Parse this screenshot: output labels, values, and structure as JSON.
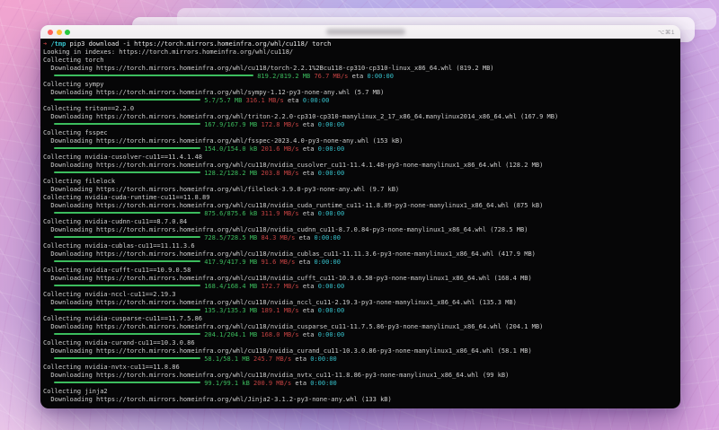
{
  "window": {
    "shortcut_badge": "⌥⌘1",
    "traffic_lights": [
      {
        "name": "close",
        "color": "#ff5f57"
      },
      {
        "name": "minimize",
        "color": "#febc2e"
      },
      {
        "name": "zoom",
        "color": "#28c840"
      }
    ]
  },
  "terminal": {
    "colors": {
      "green": "#3cbd5e",
      "red": "#c44242",
      "cyan": "#36c2cc",
      "foreground": "#cfcfcf",
      "background": "#060607"
    },
    "prompt": {
      "arrow": "➜",
      "cwd": "/tmp"
    },
    "lines": [
      {
        "type": "cmd",
        "command": "pip3 download -i https://torch.mirrors.homeinfra.org/whl/cu118/ torch"
      },
      {
        "type": "out",
        "text": "Looking in indexes: https://torch.mirrors.homeinfra.org/whl/cu118/"
      },
      {
        "type": "out",
        "text": "Collecting torch"
      },
      {
        "type": "out",
        "text": "  Downloading https://torch.mirrors.homeinfra.org/whl/cu118/torch-2.2.1%2Bcu118-cp310-cp310-linux_x86_64.whl (819.2 MB)"
      },
      {
        "type": "progress",
        "barw": 222,
        "done": "819.2/819.2 MB",
        "speed": "76.7 MB/s",
        "eta_label": "eta",
        "eta": "0:00:00"
      },
      {
        "type": "out",
        "text": "Collecting sympy"
      },
      {
        "type": "out",
        "text": "  Downloading https://torch.mirrors.homeinfra.org/whl/sympy-1.12-py3-none-any.whl (5.7 MB)"
      },
      {
        "type": "progress",
        "barw": 163,
        "done": "5.7/5.7 MB",
        "speed": "316.1 MB/s",
        "eta_label": "eta",
        "eta": "0:00:00"
      },
      {
        "type": "out",
        "text": "Collecting triton==2.2.0"
      },
      {
        "type": "out",
        "text": "  Downloading https://torch.mirrors.homeinfra.org/whl/triton-2.2.0-cp310-cp310-manylinux_2_17_x86_64.manylinux2014_x86_64.whl (167.9 MB)"
      },
      {
        "type": "progress",
        "barw": 163,
        "done": "167.9/167.9 MB",
        "speed": "172.8 MB/s",
        "eta_label": "eta",
        "eta": "0:00:00"
      },
      {
        "type": "out",
        "text": "Collecting fsspec"
      },
      {
        "type": "out",
        "text": "  Downloading https://torch.mirrors.homeinfra.org/whl/fsspec-2023.4.0-py3-none-any.whl (153 kB)"
      },
      {
        "type": "progress",
        "barw": 163,
        "done": "154.0/154.0 kB",
        "speed": "201.6 MB/s",
        "eta_label": "eta",
        "eta": "0:00:00"
      },
      {
        "type": "out",
        "text": "Collecting nvidia-cusolver-cu11==11.4.1.48"
      },
      {
        "type": "out",
        "text": "  Downloading https://torch.mirrors.homeinfra.org/whl/cu118/nvidia_cusolver_cu11-11.4.1.48-py3-none-manylinux1_x86_64.whl (128.2 MB)"
      },
      {
        "type": "progress",
        "barw": 163,
        "done": "128.2/128.2 MB",
        "speed": "203.8 MB/s",
        "eta_label": "eta",
        "eta": "0:00:00"
      },
      {
        "type": "out",
        "text": "Collecting filelock"
      },
      {
        "type": "out",
        "text": "  Downloading https://torch.mirrors.homeinfra.org/whl/filelock-3.9.0-py3-none-any.whl (9.7 kB)"
      },
      {
        "type": "out",
        "text": "Collecting nvidia-cuda-runtime-cu11==11.8.89"
      },
      {
        "type": "out",
        "text": "  Downloading https://torch.mirrors.homeinfra.org/whl/cu118/nvidia_cuda_runtime_cu11-11.8.89-py3-none-manylinux1_x86_64.whl (875 kB)"
      },
      {
        "type": "progress",
        "barw": 163,
        "done": "875.6/875.6 kB",
        "speed": "311.9 MB/s",
        "eta_label": "eta",
        "eta": "0:00:00"
      },
      {
        "type": "out",
        "text": "Collecting nvidia-cudnn-cu11==8.7.0.84"
      },
      {
        "type": "out",
        "text": "  Downloading https://torch.mirrors.homeinfra.org/whl/cu118/nvidia_cudnn_cu11-8.7.0.84-py3-none-manylinux1_x86_64.whl (728.5 MB)"
      },
      {
        "type": "progress",
        "barw": 163,
        "done": "728.5/728.5 MB",
        "speed": "84.3 MB/s",
        "eta_label": "eta",
        "eta": "0:00:00"
      },
      {
        "type": "out",
        "text": "Collecting nvidia-cublas-cu11==11.11.3.6"
      },
      {
        "type": "out",
        "text": "  Downloading https://torch.mirrors.homeinfra.org/whl/cu118/nvidia_cublas_cu11-11.11.3.6-py3-none-manylinux1_x86_64.whl (417.9 MB)"
      },
      {
        "type": "progress",
        "barw": 163,
        "done": "417.9/417.9 MB",
        "speed": "91.6 MB/s",
        "eta_label": "eta",
        "eta": "0:00:00"
      },
      {
        "type": "out",
        "text": "Collecting nvidia-cufft-cu11==10.9.0.58"
      },
      {
        "type": "out",
        "text": "  Downloading https://torch.mirrors.homeinfra.org/whl/cu118/nvidia_cufft_cu11-10.9.0.58-py3-none-manylinux1_x86_64.whl (168.4 MB)"
      },
      {
        "type": "progress",
        "barw": 163,
        "done": "168.4/168.4 MB",
        "speed": "172.7 MB/s",
        "eta_label": "eta",
        "eta": "0:00:00"
      },
      {
        "type": "out",
        "text": "Collecting nvidia-nccl-cu11==2.19.3"
      },
      {
        "type": "out",
        "text": "  Downloading https://torch.mirrors.homeinfra.org/whl/cu118/nvidia_nccl_cu11-2.19.3-py3-none-manylinux1_x86_64.whl (135.3 MB)"
      },
      {
        "type": "progress",
        "barw": 163,
        "done": "135.3/135.3 MB",
        "speed": "189.1 MB/s",
        "eta_label": "eta",
        "eta": "0:00:00"
      },
      {
        "type": "out",
        "text": "Collecting nvidia-cusparse-cu11==11.7.5.86"
      },
      {
        "type": "out",
        "text": "  Downloading https://torch.mirrors.homeinfra.org/whl/cu118/nvidia_cusparse_cu11-11.7.5.86-py3-none-manylinux1_x86_64.whl (204.1 MB)"
      },
      {
        "type": "progress",
        "barw": 163,
        "done": "204.1/204.1 MB",
        "speed": "168.0 MB/s",
        "eta_label": "eta",
        "eta": "0:00:00"
      },
      {
        "type": "out",
        "text": "Collecting nvidia-curand-cu11==10.3.0.86"
      },
      {
        "type": "out",
        "text": "  Downloading https://torch.mirrors.homeinfra.org/whl/cu118/nvidia_curand_cu11-10.3.0.86-py3-none-manylinux1_x86_64.whl (58.1 MB)"
      },
      {
        "type": "progress",
        "barw": 163,
        "done": "58.1/58.1 MB",
        "speed": "245.7 MB/s",
        "eta_label": "eta",
        "eta": "0:00:00"
      },
      {
        "type": "out",
        "text": "Collecting nvidia-nvtx-cu11==11.8.86"
      },
      {
        "type": "out",
        "text": "  Downloading https://torch.mirrors.homeinfra.org/whl/cu118/nvidia_nvtx_cu11-11.8.86-py3-none-manylinux1_x86_64.whl (99 kB)"
      },
      {
        "type": "progress",
        "barw": 163,
        "done": "99.1/99.1 kB",
        "speed": "200.9 MB/s",
        "eta_label": "eta",
        "eta": "0:00:00"
      },
      {
        "type": "out",
        "text": "Collecting jinja2"
      },
      {
        "type": "out",
        "text": "  Downloading https://torch.mirrors.homeinfra.org/whl/Jinja2-3.1.2-py3-none-any.whl (133 kB)"
      }
    ]
  }
}
